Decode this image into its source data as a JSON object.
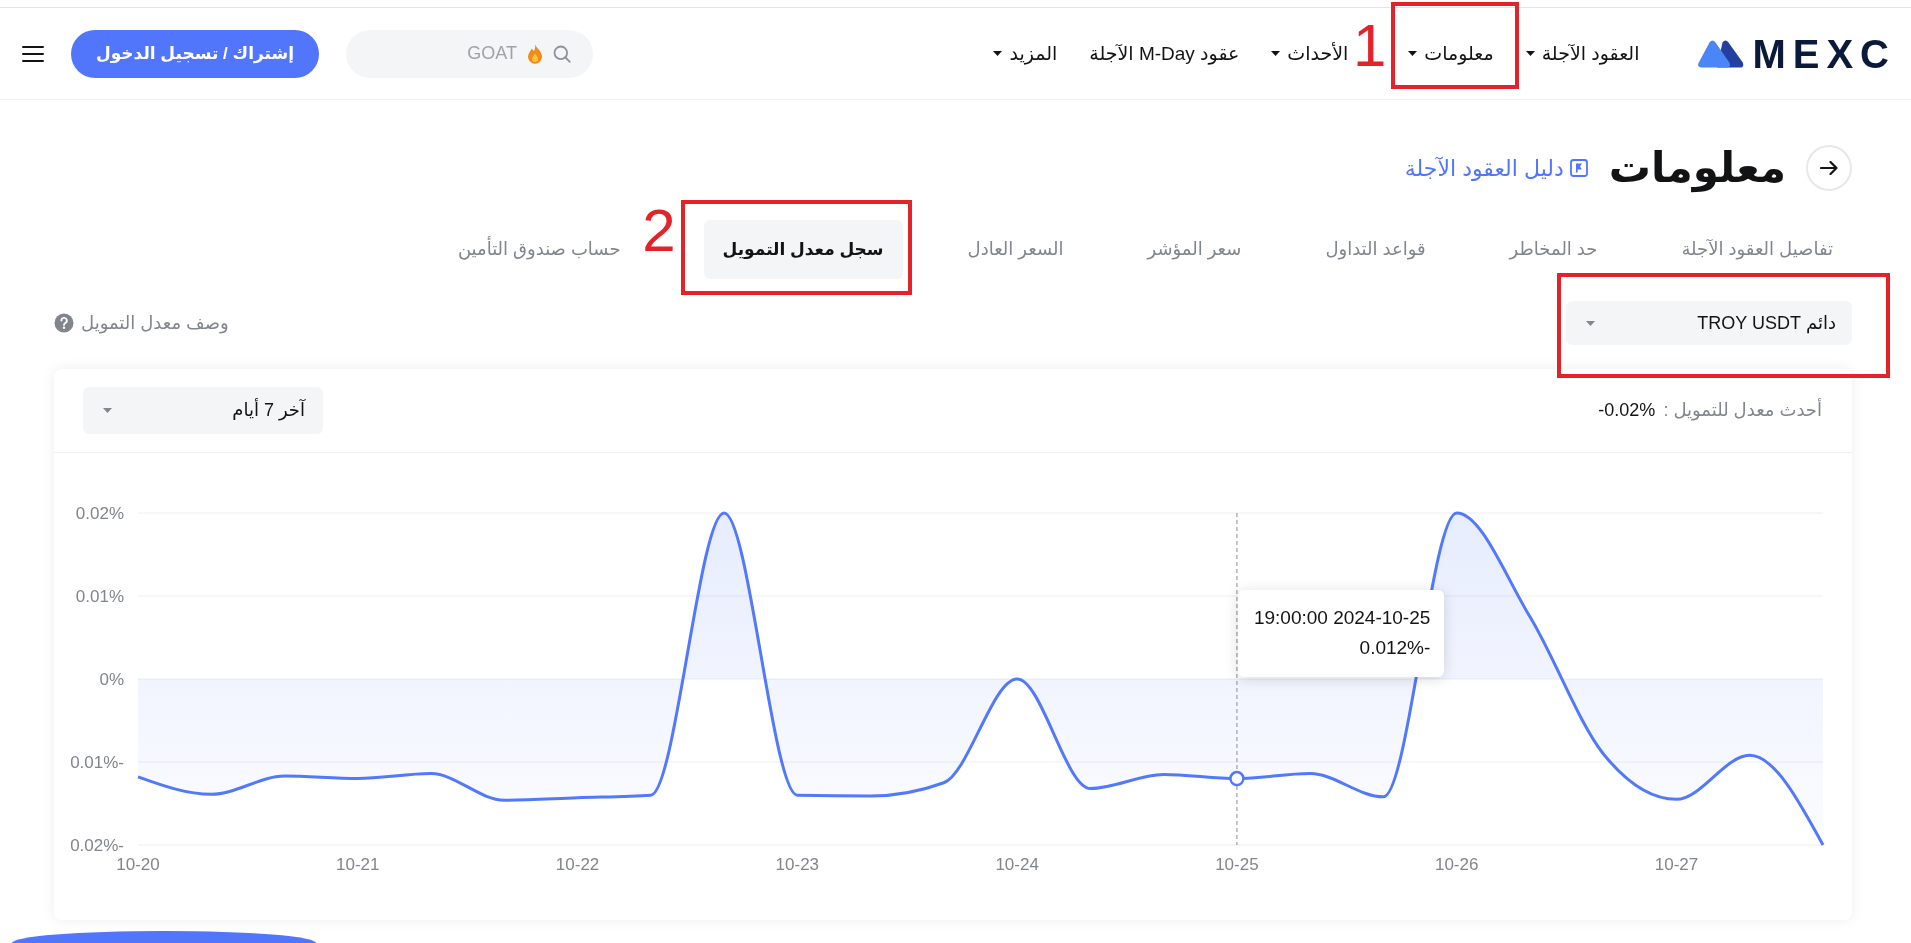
{
  "header": {
    "logo": {
      "text": "MEXC"
    },
    "nav": [
      {
        "label": "العقود الآجلة",
        "dropdown": true,
        "framed": false
      },
      {
        "label": "معلومات",
        "dropdown": true,
        "framed": true,
        "callout": "1"
      },
      {
        "label": "الأحداث",
        "dropdown": true,
        "framed": false
      },
      {
        "label": "عقود M-Day الآجلة",
        "dropdown": false,
        "framed": false
      },
      {
        "label": "المزيد",
        "dropdown": true,
        "framed": false
      }
    ],
    "search": {
      "placeholder": "GOAT"
    },
    "signup_button": "إشتراك / تسجيل الدخول"
  },
  "page_header": {
    "title": "معلومات",
    "guide_link": "دليل العقود الآجلة"
  },
  "tabs": [
    {
      "label": "تفاصيل العقود الآجلة",
      "selected": false,
      "framed": false
    },
    {
      "label": "حد المخاطر",
      "selected": false,
      "framed": false
    },
    {
      "label": "قواعد التداول",
      "selected": false,
      "framed": false
    },
    {
      "label": "سعر المؤشر",
      "selected": false,
      "framed": false
    },
    {
      "label": "السعر العادل",
      "selected": false,
      "framed": false
    },
    {
      "label": "سجل معدل التمويل",
      "selected": true,
      "framed": true,
      "callout": "2"
    },
    {
      "label": "حساب صندوق التأمين",
      "selected": false,
      "framed": false
    }
  ],
  "contract_select": {
    "value": "دائم TROY USDT",
    "framed": true
  },
  "funding_description_link": "وصف معدل التمويل",
  "chart_card": {
    "period_select": {
      "value": "آخر 7 أيام"
    },
    "latest_rate": {
      "label": "أحدث معدل للتمويل :",
      "value": "-0.02%"
    },
    "chart_data": {
      "type": "area",
      "categories": [
        "10-20",
        null,
        null,
        "10-21",
        null,
        null,
        "10-22",
        null,
        null,
        "10-23",
        null,
        null,
        "10-24",
        null,
        null,
        "10-25",
        null,
        null,
        "10-26",
        null,
        null,
        "10-27",
        null,
        null
      ],
      "series": [
        {
          "color": "#5279fb",
          "values": [
            -0.0118,
            -0.0139,
            -0.0117,
            -0.012,
            -0.0114,
            -0.0146,
            -0.0143,
            -0.014,
            0.02,
            -0.014,
            -0.0141,
            -0.0125,
            0,
            -0.0132,
            -0.0115,
            -0.012,
            -0.0114,
            -0.0142,
            0.02,
            0.0075,
            -0.009,
            -0.0145,
            -0.0092,
            -0.02
          ]
        }
      ],
      "ylim": [
        -0.02,
        0.02
      ],
      "yticks": [
        {
          "value": 0.02,
          "label": "0.02%"
        },
        {
          "value": 0.01,
          "label": "0.01%"
        },
        {
          "value": 0,
          "label": "0%"
        },
        {
          "value": -0.01,
          "label": "0.01%-"
        },
        {
          "value": -0.02,
          "label": "0.02%-"
        }
      ],
      "grid": true,
      "ref_lines": [
        {
          "axis": "x",
          "value": "10-25"
        }
      ],
      "annotations": [
        "19:00:00 2024-10-25",
        "0.012%-"
      ]
    }
  }
}
